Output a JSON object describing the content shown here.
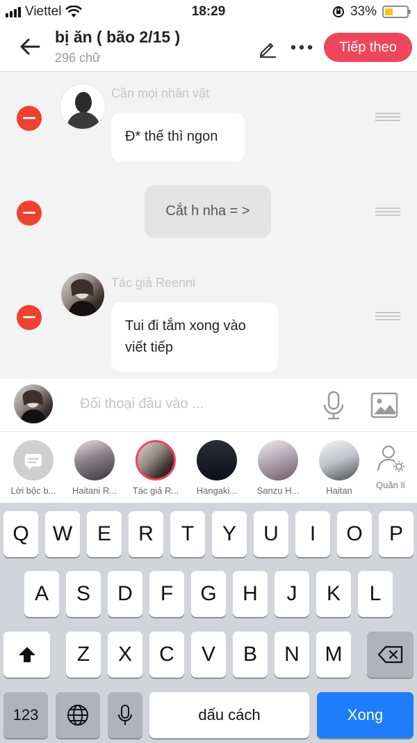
{
  "status_bar": {
    "carrier": "Viettel",
    "time": "18:29",
    "battery_pct": "33%"
  },
  "header": {
    "title": "bị ăn ( bão 2/15 )",
    "subtitle": "296 chữ",
    "next_label": "Tiếp theo"
  },
  "messages": [
    {
      "speaker": "Cần mọi nhân vật",
      "text": "Đ* thế thì ngon"
    },
    {
      "speaker": "",
      "text": "Cắt h nha = >"
    },
    {
      "speaker": "Tác giả Reenni",
      "text_line1": "Tui đi tắm xong vào",
      "text_line2": "viết tiếp"
    }
  ],
  "composer": {
    "placeholder": "Đối thoại đầu vào ..."
  },
  "characters": [
    {
      "label": "Lời bộc b..."
    },
    {
      "label": "Haitani R..."
    },
    {
      "label": "Tác giả R..."
    },
    {
      "label": "Hangaki..."
    },
    {
      "label": "Sanzu H..."
    },
    {
      "label": "Haitan"
    }
  ],
  "manage_label": "Quản lí",
  "keyboard": {
    "row1": [
      "Q",
      "W",
      "E",
      "R",
      "T",
      "Y",
      "U",
      "I",
      "O",
      "P"
    ],
    "row2": [
      "A",
      "S",
      "D",
      "F",
      "G",
      "H",
      "J",
      "K",
      "L"
    ],
    "row3": [
      "Z",
      "X",
      "C",
      "V",
      "B",
      "N",
      "M"
    ],
    "numbers": "123",
    "space": "dấu cách",
    "done": "Xong"
  },
  "colors": {
    "accent": "#f0465a",
    "remove": "#f0402e",
    "keyboard_done": "#1e7dfa"
  }
}
